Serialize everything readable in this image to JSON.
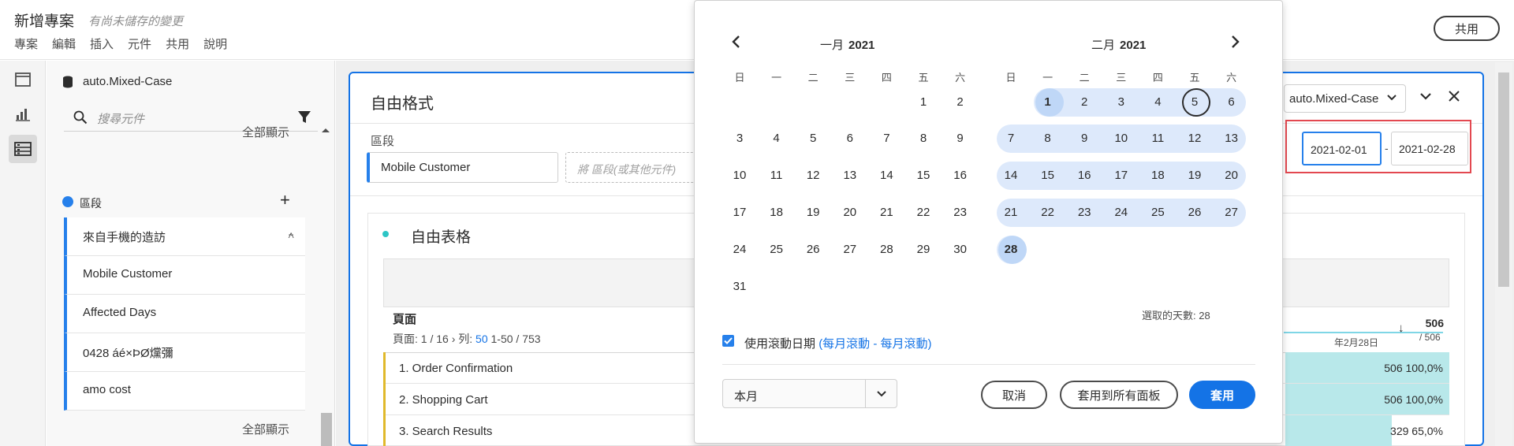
{
  "app": {
    "title": "新增專案",
    "unsaved": "有尚未儲存的變更",
    "menu": [
      "專案",
      "編輯",
      "插入",
      "元件",
      "共用",
      "說明"
    ],
    "share": "共用"
  },
  "leftpanel": {
    "data_source": "auto.Mixed-Case",
    "search_placeholder": "搜尋元件",
    "show_all": "全部顯示",
    "segments_title": "區段",
    "segments": [
      "來自手機的造訪",
      "Mobile Customer",
      "Affected Days",
      "0428 áé×ÞØ爣彌",
      "amo cost"
    ],
    "show_all_bottom": "全部顯示"
  },
  "panel": {
    "title": "自由格式",
    "drop_label": "區段",
    "chip": "Mobile Customer",
    "drop_placeholder": "將 區段(或其他元件)",
    "report_suite": "auto.Mixed-Case",
    "date_start": "2021-02-01",
    "date_end": "2021-02-28",
    "date_sep": "-"
  },
  "table": {
    "title": "自由表格",
    "dimension": "頁面",
    "pager_prefix": "頁面:",
    "pager_pages": "1 / 16",
    "pager_rows_label": "列:",
    "pager_rows": "50",
    "pager_range": "1-50 / 753",
    "metric_total": "506",
    "metric_sub": "/ 506",
    "metric_date": "年2月28日",
    "rows": [
      {
        "label": "1. Order Confirmation",
        "value": "506 100,0%",
        "fill": 1.0
      },
      {
        "label": "2. Shopping Cart",
        "value": "506 100,0%",
        "fill": 1.0
      },
      {
        "label": "3. Search Results",
        "value": "329 65,0%",
        "fill": 0.65
      }
    ]
  },
  "calendar": {
    "left": {
      "month": "一月",
      "year": "2021"
    },
    "right": {
      "month": "二月",
      "year": "2021"
    },
    "weekdays": [
      "日",
      "一",
      "二",
      "三",
      "四",
      "五",
      "六"
    ],
    "days_selected": "選取的天數: 28",
    "rolling_label": "使用滾動日期",
    "rolling_detail": "(每月滾動 - 每月滾動)",
    "preset": "本月",
    "cancel": "取消",
    "apply_all": "套用到所有面板",
    "apply": "套用"
  },
  "colors": {
    "accent": "#1473e6",
    "selection": "#dde9fb",
    "highlight": "#e34850",
    "bar": "#b8e8ea"
  }
}
